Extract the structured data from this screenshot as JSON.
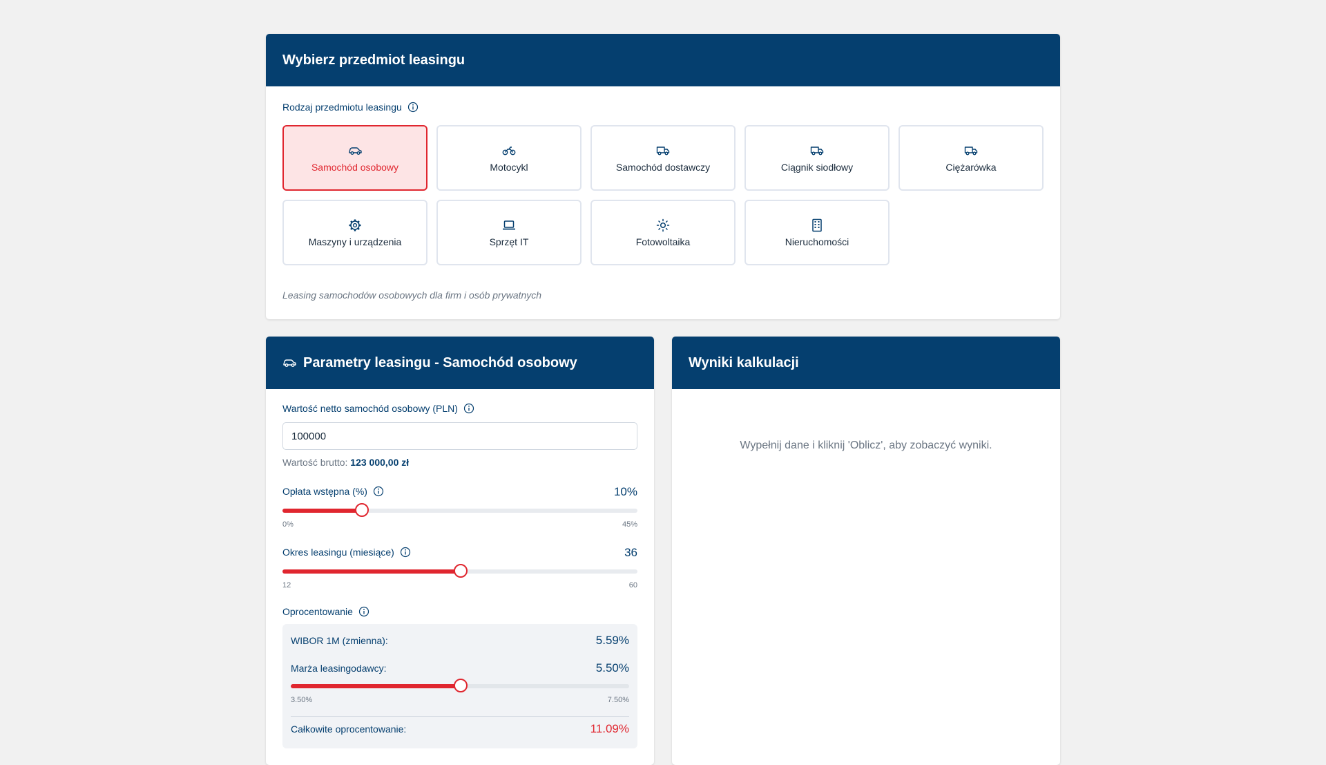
{
  "select": {
    "title": "Wybierz przedmiot leasingu",
    "type_label": "Rodzaj przedmiotu leasingu",
    "tiles": [
      {
        "label": "Samochód osobowy",
        "icon": "car-icon",
        "selected": true
      },
      {
        "label": "Motocykl",
        "icon": "motorcycle-icon",
        "selected": false
      },
      {
        "label": "Samochód dostawczy",
        "icon": "truck-icon",
        "selected": false
      },
      {
        "label": "Ciągnik siodłowy",
        "icon": "truck-icon",
        "selected": false
      },
      {
        "label": "Ciężarówka",
        "icon": "truck-icon",
        "selected": false
      },
      {
        "label": "Maszyny i urządzenia",
        "icon": "gear-icon",
        "selected": false
      },
      {
        "label": "Sprzęt IT",
        "icon": "laptop-icon",
        "selected": false
      },
      {
        "label": "Fotowoltaika",
        "icon": "sun-icon",
        "selected": false
      },
      {
        "label": "Nieruchomości",
        "icon": "building-icon",
        "selected": false
      }
    ],
    "description": "Leasing samochodów osobowych dla firm i osób prywatnych"
  },
  "params": {
    "title": "Parametry leasingu - Samochód osobowy",
    "net_label": "Wartość netto samochód osobowy (PLN)",
    "net_value": "100000",
    "gross_prefix": "Wartość brutto:",
    "gross_value": "123 000,00 zł",
    "down_payment": {
      "label": "Opłata wstępna (%)",
      "display": "10%",
      "value": 10,
      "min": 0,
      "max": 45,
      "min_label": "0%",
      "max_label": "45%"
    },
    "period": {
      "label": "Okres leasingu (miesiące)",
      "display": "36",
      "value": 36,
      "min": 12,
      "max": 60,
      "min_label": "12",
      "max_label": "60"
    },
    "interest": {
      "label": "Oprocentowanie",
      "wibor_label": "WIBOR 1M (zmienna):",
      "wibor_value": "5.59%",
      "margin_label": "Marża leasingodawcy:",
      "margin_value": "5.50%",
      "margin": {
        "value": 5.5,
        "min": 3.5,
        "max": 7.5,
        "min_label": "3.50%",
        "max_label": "7.50%"
      },
      "total_label": "Całkowite oprocentowanie:",
      "total_value": "11.09%"
    }
  },
  "results": {
    "title": "Wyniki kalkulacji",
    "empty_message": "Wypełnij dane i kliknij 'Oblicz', aby zobaczyć wyniki."
  },
  "colors": {
    "primary": "#053f6f",
    "accent": "#e0262f",
    "accent_bg": "#fde4e5"
  }
}
